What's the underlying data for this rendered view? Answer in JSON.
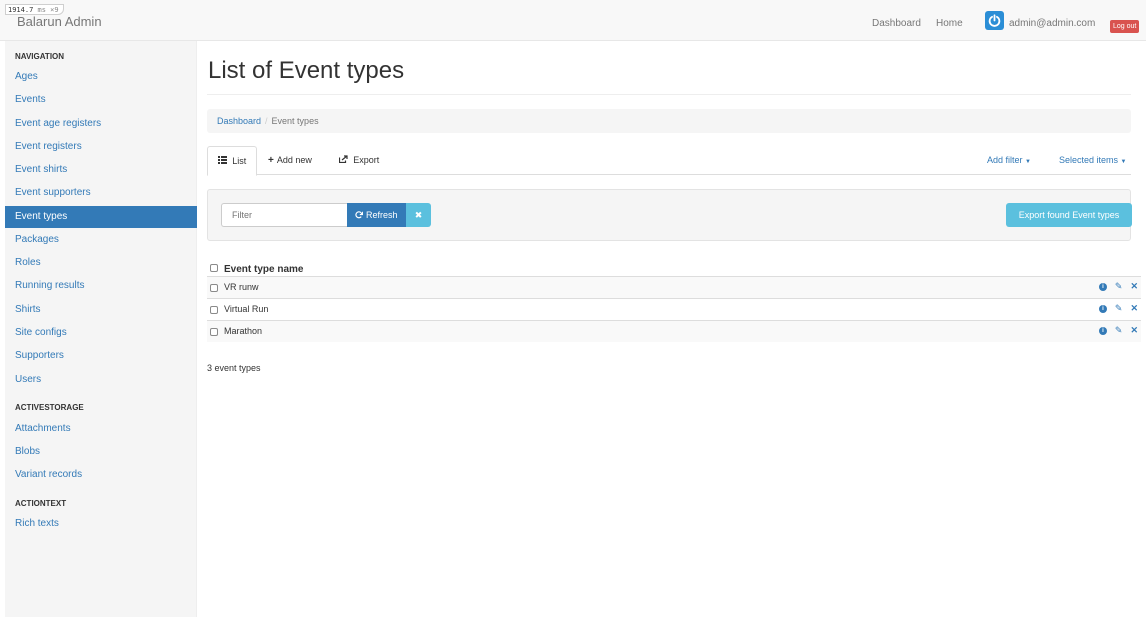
{
  "perf": {
    "time": "1914.7",
    "unit": "ms",
    "extra": "×9"
  },
  "brand": "Balarun Admin",
  "topnav": {
    "dashboard": "Dashboard",
    "home": "Home",
    "user_email": "admin@admin.com",
    "logout": "Log out",
    "avatar_icon": "power-icon",
    "colors": {
      "navbar_bg": "#f8f8f8",
      "logout": "#d9534f",
      "avatar": "#2b8ed6"
    }
  },
  "sidebar": {
    "navigation_heading": "NAVIGATION",
    "navigation_items": [
      {
        "label": "Ages",
        "active": false
      },
      {
        "label": "Events",
        "active": false
      },
      {
        "label": "Event age registers",
        "active": false
      },
      {
        "label": "Event registers",
        "active": false
      },
      {
        "label": "Event shirts",
        "active": false
      },
      {
        "label": "Event supporters",
        "active": false
      },
      {
        "label": "Event types",
        "active": true
      },
      {
        "label": "Packages",
        "active": false
      },
      {
        "label": "Roles",
        "active": false
      },
      {
        "label": "Running results",
        "active": false
      },
      {
        "label": "Shirts",
        "active": false
      },
      {
        "label": "Site configs",
        "active": false
      },
      {
        "label": "Supporters",
        "active": false
      },
      {
        "label": "Users",
        "active": false
      }
    ],
    "activestorage_heading": "ACTIVESTORAGE",
    "activestorage_items": [
      {
        "label": "Attachments"
      },
      {
        "label": "Blobs"
      },
      {
        "label": "Variant records"
      }
    ],
    "actiontext_heading": "ACTIONTEXT",
    "actiontext_items": [
      {
        "label": "Rich texts"
      }
    ],
    "colors": {
      "active_bg": "#337ab7",
      "link": "#337ab7"
    }
  },
  "main": {
    "title": "List of Event types",
    "breadcrumb": {
      "dashboard": "Dashboard",
      "separator": "/",
      "current": "Event types"
    },
    "tabs": {
      "list": {
        "label": "List",
        "icon": "list-icon"
      },
      "add_new": {
        "label": "Add new",
        "icon": "plus-icon"
      },
      "export": {
        "label": "Export",
        "icon": "share-icon"
      },
      "add_filter": "Add filter",
      "selected_items": "Selected items"
    },
    "filter": {
      "placeholder": "Filter",
      "value": "",
      "refresh_label": "Refresh",
      "refresh_icon": "refresh-icon",
      "clear_icon": "close-icon",
      "export_label": "Export found Event types"
    },
    "table": {
      "column_header": "Event type name",
      "rows": [
        {
          "name": "VR runw"
        },
        {
          "name": "Virtual Run"
        },
        {
          "name": "Marathon"
        }
      ],
      "row_actions": [
        "info-icon",
        "pencil-icon",
        "delete-icon"
      ]
    },
    "count_text": "3 event types"
  }
}
